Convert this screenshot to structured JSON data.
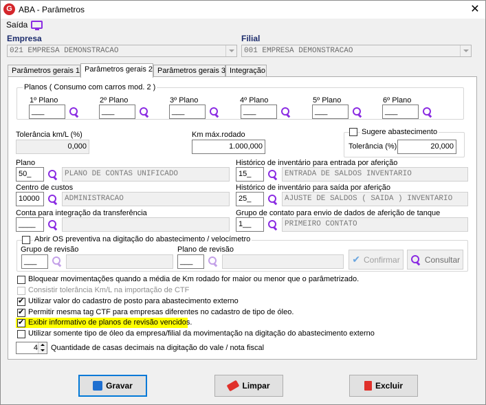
{
  "window": {
    "title": "ABA - Parâmetros",
    "app_icon_letter": "G",
    "close_glyph": "✕"
  },
  "menu": {
    "saida": "Saída"
  },
  "empresa": {
    "label": "Empresa",
    "value": "021 EMPRESA DEMONSTRACAO"
  },
  "filial": {
    "label": "Filial",
    "value": "001 EMPRESA DEMONSTRACAO"
  },
  "tabs": [
    {
      "label": "Parâmetros gerais 1"
    },
    {
      "label": "Parâmetros gerais 2"
    },
    {
      "label": "Parâmetros gerais 3"
    },
    {
      "label": "Integração"
    }
  ],
  "planos": {
    "title": "Planos ( Consumo com carros mod. 2 )",
    "items": [
      {
        "label": "1º Plano",
        "value": "___"
      },
      {
        "label": "2º Plano",
        "value": "___"
      },
      {
        "label": "3º Plano",
        "value": "___"
      },
      {
        "label": "4º Plano",
        "value": "___"
      },
      {
        "label": "5º Plano",
        "value": "___"
      },
      {
        "label": "6º Plano",
        "value": "___"
      }
    ]
  },
  "tolerancia_kml": {
    "label": "Tolerância km/L (%)",
    "value": "0,000"
  },
  "km_max": {
    "label": "Km máx.rodado",
    "value": "1.000,000"
  },
  "sugere": {
    "label": "Sugere abastecimento",
    "tol_label": "Tolerância (%)",
    "tol_value": "20,000"
  },
  "plano": {
    "label": "Plano",
    "code": "50_",
    "desc": "PLANO DE CONTAS UNIFICADO"
  },
  "hist_entrada": {
    "label": "Histórico de inventário para entrada por aferição",
    "code": "15_",
    "desc": "ENTRADA DE SALDOS INVENTARIO"
  },
  "centro_custos": {
    "label": "Centro de custos",
    "code": "10000",
    "desc": "ADMINISTRACAO"
  },
  "hist_saida": {
    "label": "Histórico de inventário para saída por aferição",
    "code": "25_",
    "desc": "AJUSTE DE SALDOS ( SAIDA ) INVENTARIO"
  },
  "conta_integracao": {
    "label": "Conta para integração da transferência",
    "code": "____",
    "desc": ""
  },
  "grupo_contato": {
    "label": "Grupo de contato para envio de dados de aferição de tanque",
    "code": "1__",
    "desc": "PRIMEIRO CONTATO"
  },
  "os_preventiva": {
    "label": "Abrir OS preventiva na digitação do abastecimento / velocímetro",
    "grupo_label": "Grupo de revisão",
    "grupo_value": "___",
    "plano_label": "Plano de revisão",
    "plano_value": "___",
    "confirmar": "Confirmar",
    "consultar": "Consultar"
  },
  "options": [
    {
      "label": "Bloquear movimentações quando a média de Km rodado for maior ou menor que o parâmetrizado.",
      "checked": false,
      "disabled": false,
      "highlight": false
    },
    {
      "label": "Consistir tolerância Km/L na importação de CTF",
      "checked": false,
      "disabled": true,
      "highlight": false
    },
    {
      "label": "Utilizar valor do cadastro de posto para abastecimento externo",
      "checked": true,
      "disabled": false,
      "highlight": false
    },
    {
      "label": "Permitir mesma tag CTF para empresas diferentes no cadastro de tipo de óleo.",
      "checked": true,
      "disabled": false,
      "highlight": false
    },
    {
      "label": "Exibir informativo de planos de revisão vencidos.",
      "checked": true,
      "disabled": false,
      "highlight": true
    },
    {
      "label": "Utilizar somente tipo de óleo da empresa/filial da movimentação na digitação do abastecimento externo",
      "checked": false,
      "disabled": false,
      "highlight": false
    }
  ],
  "casas_decimais": {
    "value": "4",
    "label": "Quantidade de casas decimais na digitação do vale / nota fiscal"
  },
  "buttons": {
    "gravar": "Gravar",
    "limpar": "Limpar",
    "excluir": "Excluir"
  },
  "colors": {
    "accent": "#8a2be2",
    "label_blue": "#1c2c6c",
    "highlight": "#ffff00",
    "focus": "#0078d7"
  }
}
